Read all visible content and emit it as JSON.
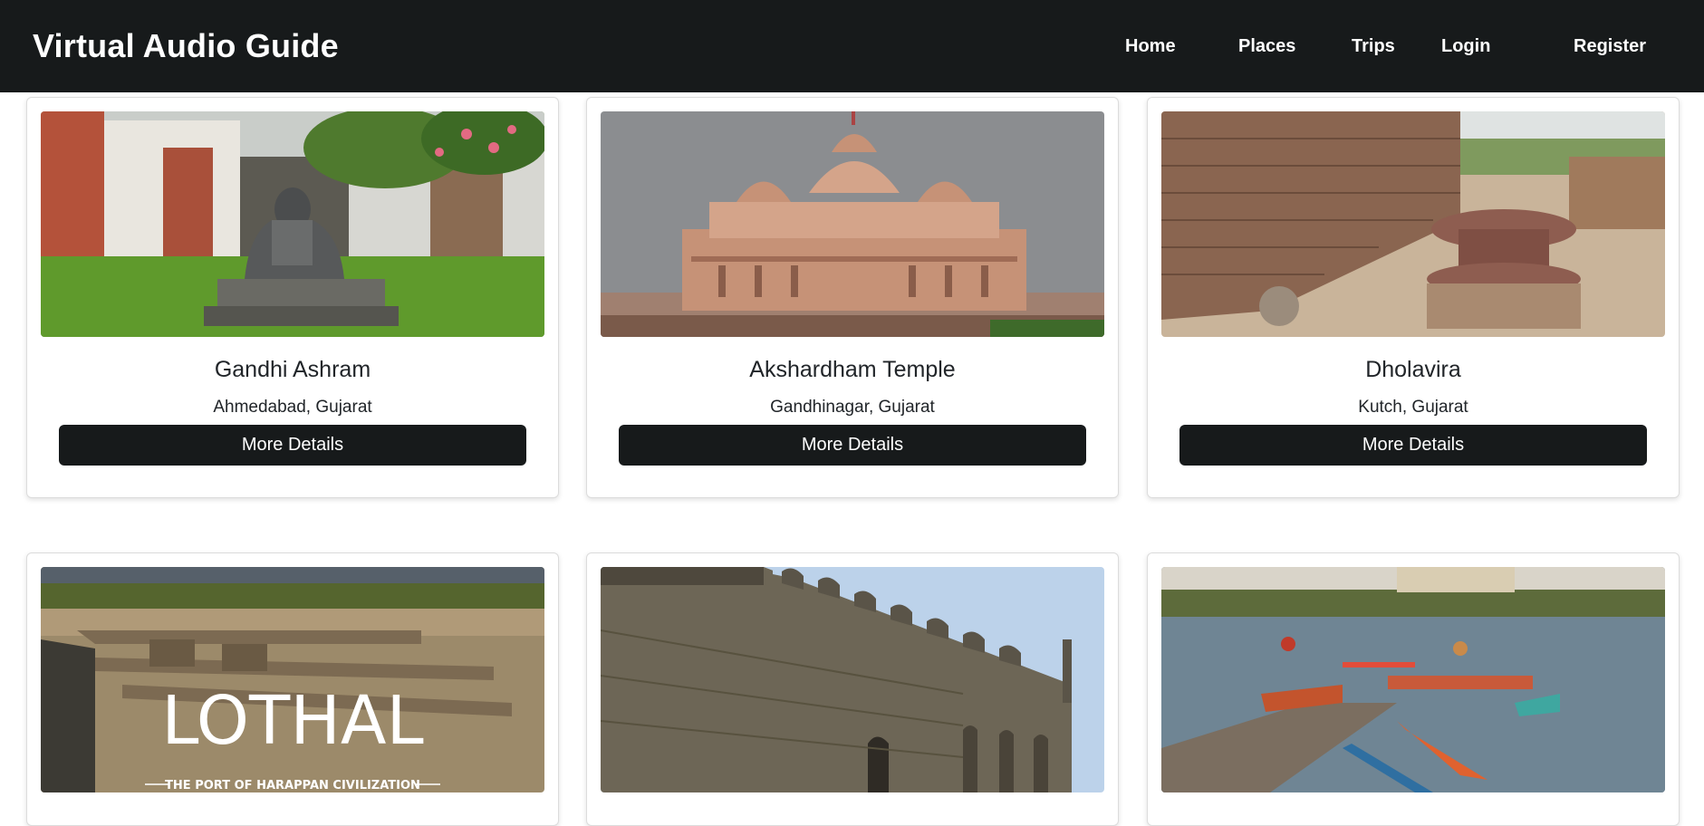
{
  "app": {
    "brand": "Virtual Audio Guide"
  },
  "nav": {
    "home": "Home",
    "places": "Places",
    "trips": "Trips",
    "login": "Login",
    "register": "Register"
  },
  "places": [
    {
      "name": "Gandhi Ashram",
      "location": "Ahmedabad, Gujarat",
      "button": "More Details",
      "image": "gandhi-statue-photo"
    },
    {
      "name": "Akshardham Temple",
      "location": "Gandhinagar, Gujarat",
      "button": "More Details",
      "image": "temple-photo"
    },
    {
      "name": "Dholavira",
      "location": "Kutch, Gujarat",
      "button": "More Details",
      "image": "ruins-photo"
    },
    {
      "name": "",
      "location": "",
      "button": "",
      "image": "lothal-photo",
      "image_text": "LOTHAL",
      "image_subtext": "THE PORT OF HARAPPAN CIVILIZATION"
    },
    {
      "name": "",
      "location": "",
      "button": "",
      "image": "fort-wall-photo"
    },
    {
      "name": "",
      "location": "",
      "button": "",
      "image": "lake-boats-photo"
    }
  ],
  "colors": {
    "navbar": "#171a1b",
    "button": "#171a1b",
    "text": "#212529"
  }
}
